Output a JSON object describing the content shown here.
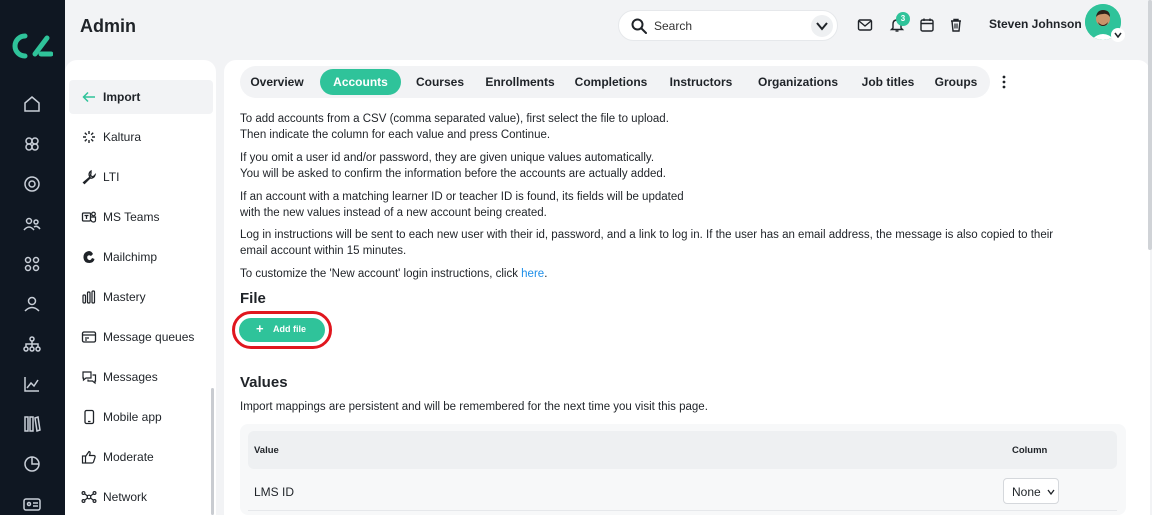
{
  "app": {
    "title": "Admin",
    "brand_color": "#2fc39a",
    "rail_color": "#0f1722"
  },
  "rail": {
    "items": [
      "home-icon",
      "modules-icon",
      "target-icon",
      "users-group-icon",
      "apps-grid-icon",
      "user-icon",
      "org-tree-icon",
      "analytics-icon",
      "library-icon",
      "reports-pie-icon",
      "id-card-icon"
    ]
  },
  "search": {
    "placeholder": "Search"
  },
  "header": {
    "notification_count": "3",
    "user_name": "Steven Johnson"
  },
  "submenu": {
    "items": [
      {
        "label": "Import",
        "icon": "arrow-left-icon",
        "active": true
      },
      {
        "label": "Kaltura",
        "icon": "kaltura-icon"
      },
      {
        "label": "LTI",
        "icon": "wrench-icon"
      },
      {
        "label": "MS Teams",
        "icon": "teams-icon"
      },
      {
        "label": "Mailchimp",
        "icon": "mailchimp-icon"
      },
      {
        "label": "Mastery",
        "icon": "bars-icon"
      },
      {
        "label": "Message queues",
        "icon": "message-queue-icon"
      },
      {
        "label": "Messages",
        "icon": "chat-icon"
      },
      {
        "label": "Mobile app",
        "icon": "mobile-icon"
      },
      {
        "label": "Moderate",
        "icon": "thumbs-up-icon"
      },
      {
        "label": "Network",
        "icon": "network-icon"
      }
    ]
  },
  "tabs": [
    {
      "label": "Overview"
    },
    {
      "label": "Accounts",
      "active": true
    },
    {
      "label": "Courses"
    },
    {
      "label": "Enrollments"
    },
    {
      "label": "Completions"
    },
    {
      "label": "Instructors"
    },
    {
      "label": "Organizations"
    },
    {
      "label": "Job titles"
    },
    {
      "label": "Groups"
    }
  ],
  "content": {
    "p1a": "To add accounts from a CSV (comma separated value), first select the file to upload.",
    "p1b": "Then indicate the column for each value and press Continue.",
    "p2a": "If you omit a user id and/or password, they are given unique values automatically.",
    "p2b": "You will be asked to confirm the information before the accounts are actually added.",
    "p3a": "If an account with a matching learner ID or teacher ID is found, its fields will be updated",
    "p3b": "with the new values instead of a new account being created.",
    "p4a": "Log in instructions will be sent to each new user with their id, password, and a link to log in. If the user has an email address, the message is also copied to their",
    "p4b": "email account within 15 minutes.",
    "p5_prefix": "To customize the 'New account' login instructions, click ",
    "p5_link": "here",
    "p5_suffix": ".",
    "file_heading": "File",
    "add_file_label": "Add file",
    "values_heading": "Values",
    "values_desc": "Import mappings are persistent and will be remembered for the next time you visit this page."
  },
  "table": {
    "headers": {
      "value": "Value",
      "column": "Column"
    },
    "rows": [
      {
        "value": "LMS ID",
        "column": "None"
      }
    ]
  }
}
